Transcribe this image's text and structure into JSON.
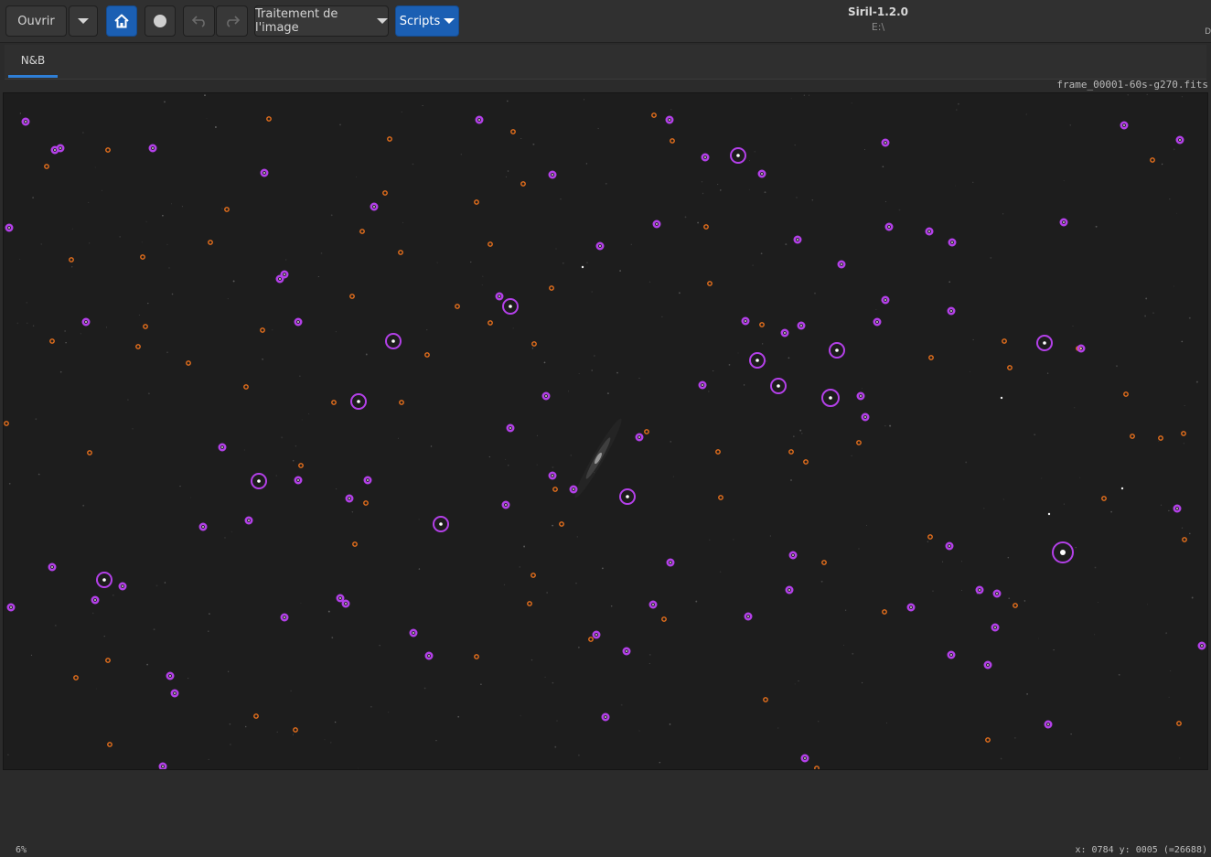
{
  "toolbar": {
    "open_label": "Ouvrir",
    "processing_label": "Traitement de l'image",
    "scripts_label": "Scripts"
  },
  "window": {
    "title": "Siril-1.2.0",
    "path": "E:\\",
    "corner_char": "D"
  },
  "tabs": [
    {
      "label": "N&B",
      "active": true
    }
  ],
  "image": {
    "filename": "frame_00001-60s-g270.fits"
  },
  "status": {
    "zoom": "6%",
    "coords": "x: 0784 y: 0005 (=26688)"
  },
  "colors": {
    "accent": "#2f7fd6",
    "button_blue": "#1b5fb3",
    "star_psf_ok": "#b340e8",
    "star_psf_other": "#e8701c",
    "canvas_bg": "#1d1d1d"
  },
  "icons": {
    "home": "home-icon",
    "record": "record-icon",
    "undo": "undo-icon",
    "redo": "redo-icon"
  }
}
